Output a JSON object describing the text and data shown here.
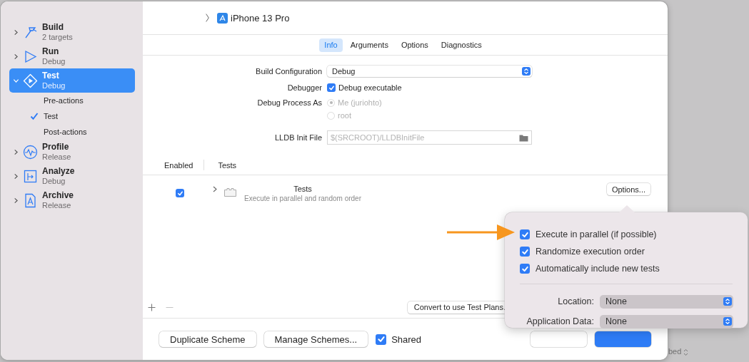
{
  "header": {
    "device": "iPhone 13 Pro"
  },
  "sidebar": {
    "items": [
      {
        "title": "Build",
        "subtitle": "2 targets",
        "expanded": false,
        "selected": false
      },
      {
        "title": "Run",
        "subtitle": "Debug",
        "expanded": false,
        "selected": false
      },
      {
        "title": "Test",
        "subtitle": "Debug",
        "expanded": true,
        "selected": true,
        "children": [
          {
            "label": "Pre-actions",
            "checked": false
          },
          {
            "label": "Test",
            "checked": true
          },
          {
            "label": "Post-actions",
            "checked": false
          }
        ]
      },
      {
        "title": "Profile",
        "subtitle": "Release",
        "expanded": false,
        "selected": false
      },
      {
        "title": "Analyze",
        "subtitle": "Debug",
        "expanded": false,
        "selected": false
      },
      {
        "title": "Archive",
        "subtitle": "Release",
        "expanded": false,
        "selected": false
      }
    ]
  },
  "tabs": [
    {
      "label": "Info",
      "selected": true
    },
    {
      "label": "Arguments",
      "selected": false
    },
    {
      "label": "Options",
      "selected": false
    },
    {
      "label": "Diagnostics",
      "selected": false
    }
  ],
  "form": {
    "build_configuration": {
      "label": "Build Configuration",
      "value": "Debug"
    },
    "debugger": {
      "label": "Debugger",
      "option": "Debug executable",
      "checked": true
    },
    "debug_process": {
      "label": "Debug Process As",
      "options": [
        {
          "label": "Me (juriohto)",
          "selected": true,
          "disabled": true
        },
        {
          "label": "root",
          "selected": false,
          "disabled": true
        }
      ]
    },
    "lldb_init_file": {
      "label": "LLDB Init File",
      "placeholder": "$(SRCROOT)/LLDBInitFile"
    }
  },
  "table": {
    "columns": [
      "Enabled",
      "Tests"
    ],
    "rows": [
      {
        "enabled": true,
        "expanded": false,
        "name": "Tests",
        "description": "Execute in parallel and random order"
      }
    ],
    "options_button": "Options..."
  },
  "convert_button": "Convert to use Test Plans.",
  "footer": {
    "duplicate_button": "Duplicate Scheme",
    "manage_button": "Manage Schemes...",
    "shared": {
      "label": "Shared",
      "checked": true
    }
  },
  "popover": {
    "checkboxes": [
      {
        "label": "Execute in parallel (if possible)",
        "checked": true
      },
      {
        "label": "Randomize execution order",
        "checked": true
      },
      {
        "label": "Automatically include new tests",
        "checked": true
      }
    ],
    "selects": [
      {
        "label": "Location:",
        "value": "None"
      },
      {
        "label": "Application Data:",
        "value": "None"
      }
    ]
  },
  "background_text": "bed"
}
